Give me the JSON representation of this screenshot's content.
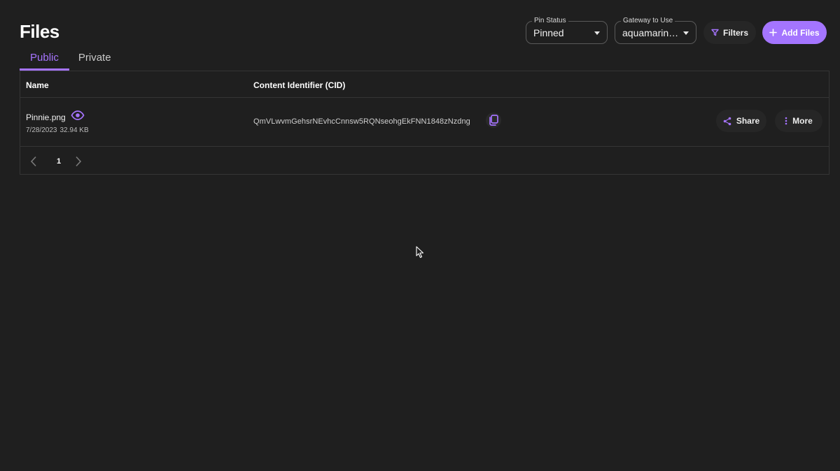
{
  "header": {
    "title": "Files"
  },
  "tabs": [
    {
      "label": "Public"
    },
    {
      "label": "Private"
    }
  ],
  "toolbar": {
    "pin_status": {
      "legend": "Pin Status",
      "value": "Pinned"
    },
    "gateway": {
      "legend": "Gateway to Use",
      "value": "aquamarin…"
    },
    "filters_label": "Filters",
    "add_files_label": "Add Files"
  },
  "table": {
    "columns": [
      "Name",
      "Content Identifier (CID)"
    ],
    "rows": [
      {
        "name": "Pinnie.png",
        "date": "7/28/2023",
        "size": "32.94 KB",
        "cid": "QmVLwvmGehsrNEvhcCnnsw5RQNseohgEkFNN1848zNzdng",
        "share_label": "Share",
        "more_label": "More"
      }
    ]
  },
  "pagination": {
    "page": "1"
  },
  "colors": {
    "accent": "#a674ff",
    "background": "#1f1f1f",
    "border": "#353535"
  },
  "icons": [
    "eye-icon",
    "copy-icon",
    "share-icon",
    "more-vertical-icon",
    "filter-icon",
    "plus-icon",
    "chevron-left-icon",
    "chevron-right-icon",
    "cursor-icon"
  ]
}
